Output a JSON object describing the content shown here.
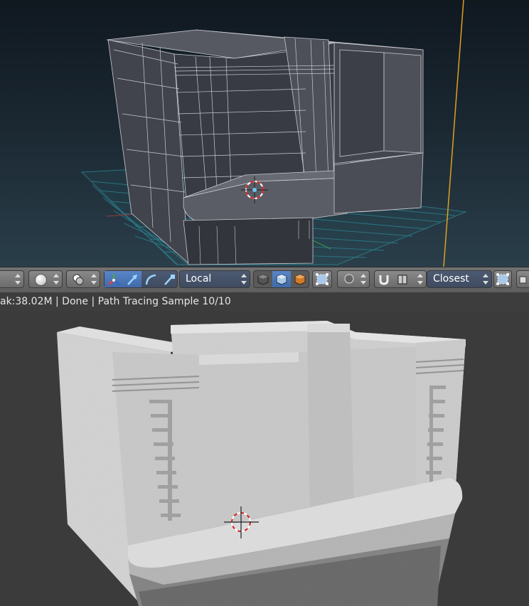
{
  "header": {
    "pivot_select_label": "Local",
    "snap_select_label": "Closest",
    "icons": [
      "vertex-dot-icon",
      "overlay-icon",
      "manipulator-axes-icon",
      "manipulator-translate-icon",
      "manipulator-rotate-icon",
      "manipulator-scale-icon",
      "cube-solid-icon",
      "cube-textured-icon",
      "cube-rendered-icon",
      "pivot-icon",
      "proportional-icon",
      "snap-magnet-icon",
      "snap-element-icon",
      "snap-target-icon",
      "render-region-icon"
    ]
  },
  "status": {
    "text": "ak:38.02M | Done | Path Tracing Sample 10/10"
  },
  "colors": {
    "wire": "#c9cbd0",
    "grid": "#2c7f8c",
    "cursor_red": "#d4211f",
    "accent_active": "#5a86c8"
  }
}
